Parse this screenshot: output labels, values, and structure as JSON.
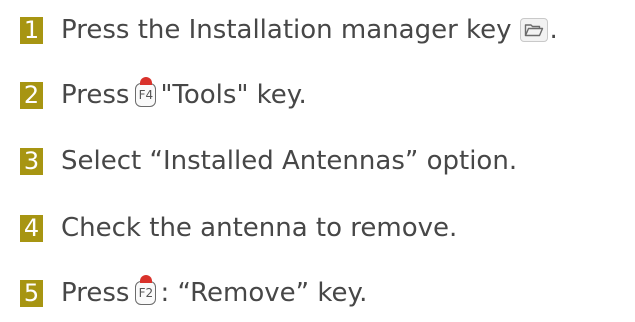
{
  "steps": [
    {
      "number": "1",
      "text": "Press the Installation manager key",
      "icon": "folder-icon",
      "end": "."
    },
    {
      "number": "2",
      "before": "Press",
      "key": "F4",
      "after": "\"Tools\" key."
    },
    {
      "number": "3",
      "text": "Select “Installed Antennas” option."
    },
    {
      "number": "4",
      "text": "Check the antenna to remove."
    },
    {
      "number": "5",
      "before": "Press",
      "key": "F2",
      "after": ": “Remove” key."
    }
  ],
  "colors": {
    "badge": "#a79512",
    "text": "#474747",
    "key_indicator": "#d9322b"
  }
}
